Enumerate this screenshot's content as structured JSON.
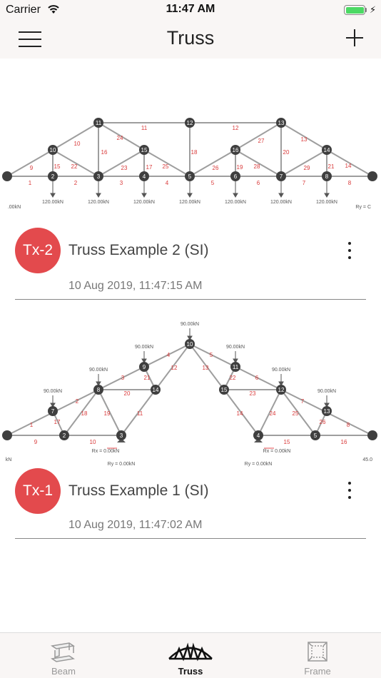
{
  "status_bar": {
    "carrier": "Carrier",
    "time": "11:47 AM"
  },
  "nav": {
    "title": "Truss"
  },
  "projects": [
    {
      "badge": "Tx-2",
      "title": "Truss Example 2 (SI)",
      "date": "10 Aug 2019, 11:47:15 AM",
      "loads": [
        "120.00kN",
        "120.00kN",
        "120.00kN",
        "120.00kN",
        "120.00kN",
        "120.00kN",
        "120.00kN",
        "120.00kN"
      ],
      "left_load": ".00kN",
      "right_reaction": "Ry = C"
    },
    {
      "badge": "Tx-1",
      "title": "Truss Example 1 (SI)",
      "date": "10 Aug 2019, 11:47:02 AM",
      "loads": [
        "90.00kN",
        "90.00kN",
        "90.00kN",
        "90.00kN",
        "90.00kN",
        "90.00kN",
        "90.00kN"
      ],
      "reactions": [
        "Rx = 0.00kN",
        "Ry = 0.00kN",
        "Rx = 0.00kN",
        "Ry = 0.00kN"
      ],
      "left_label": "kN",
      "right_label": "45.0"
    }
  ],
  "tabs": [
    {
      "label": "Beam",
      "icon": "beam-icon",
      "active": false
    },
    {
      "label": "Truss",
      "icon": "truss-icon",
      "active": true
    },
    {
      "label": "Frame",
      "icon": "frame-icon",
      "active": false
    }
  ],
  "colors": {
    "badge": "#e34a4d",
    "member_label": "#d93a3a",
    "node": "#3f3f3f"
  }
}
